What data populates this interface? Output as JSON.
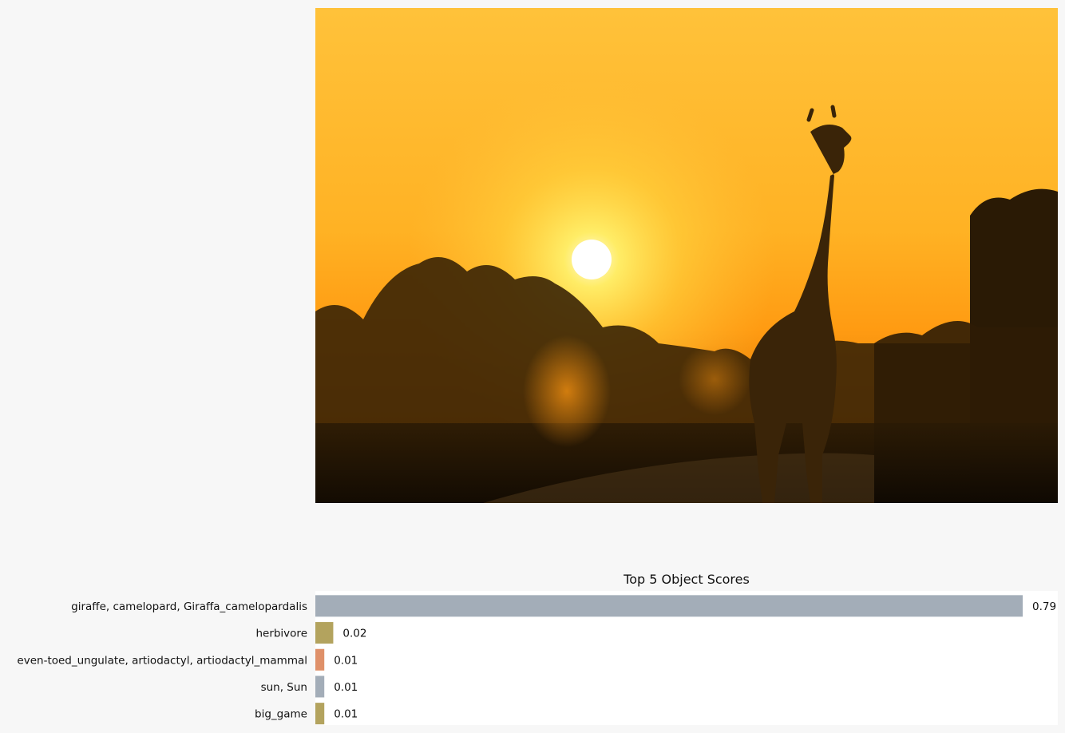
{
  "chart_data": {
    "type": "bar",
    "orientation": "horizontal",
    "title": "Top 5 Object Scores",
    "categories": [
      "giraffe, camelopard, Giraffa_camelopardalis",
      "herbivore",
      "even-toed_ungulate, artiodactyl, artiodactyl_mammal",
      "sun, Sun",
      "big_game"
    ],
    "values": [
      0.79,
      0.02,
      0.01,
      0.01,
      0.01
    ],
    "value_labels": [
      "0.79",
      "0.02",
      "0.01",
      "0.01",
      "0.01"
    ],
    "colors": [
      "#a3adb8",
      "#b3a35e",
      "#df9069",
      "#a3adb8",
      "#b3a35e"
    ],
    "grid": false,
    "legend": "none"
  },
  "image": {
    "subject": "giraffe-at-sunset-photo"
  }
}
